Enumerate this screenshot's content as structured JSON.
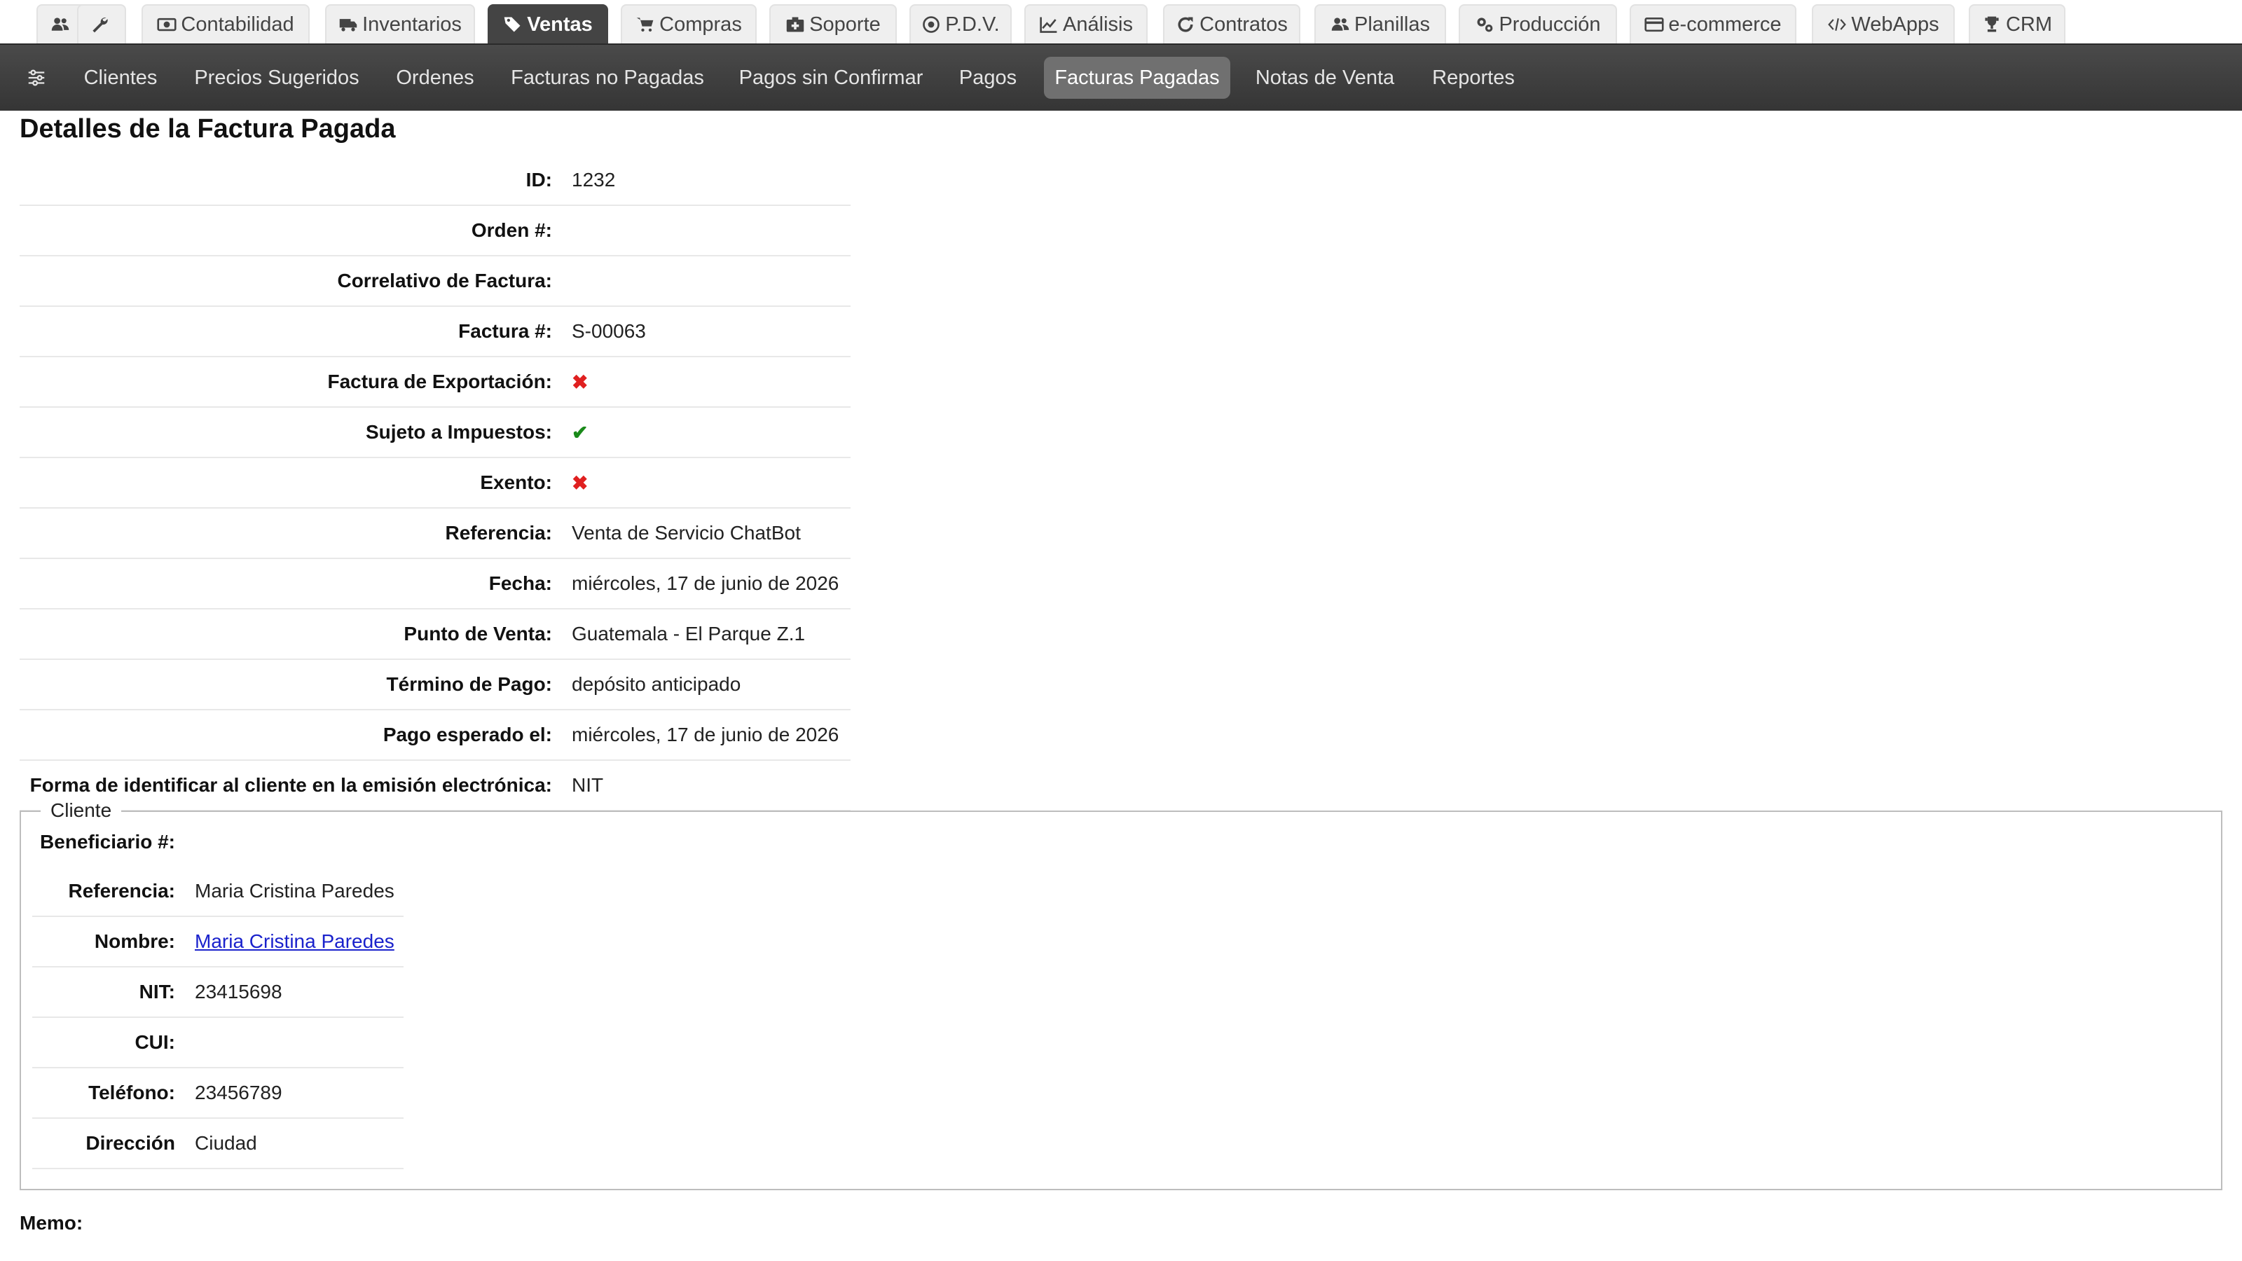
{
  "top_tabs": [
    {
      "label": "",
      "icon": "users-icon"
    },
    {
      "label": "",
      "icon": "wrench-icon"
    },
    {
      "label": "Contabilidad",
      "icon": "money-icon"
    },
    {
      "label": "Inventarios",
      "icon": "truck-icon"
    },
    {
      "label": "Ventas",
      "icon": "tags-icon",
      "active": true
    },
    {
      "label": "Compras",
      "icon": "cart-icon"
    },
    {
      "label": "Soporte",
      "icon": "medkit-icon"
    },
    {
      "label": "P.D.V.",
      "icon": "target-icon"
    },
    {
      "label": "Análisis",
      "icon": "line-chart-icon"
    },
    {
      "label": "Contratos",
      "icon": "refresh-icon"
    },
    {
      "label": "Planillas",
      "icon": "users-icon"
    },
    {
      "label": "Producción",
      "icon": "cogs-icon"
    },
    {
      "label": "e-commerce",
      "icon": "credit-card-icon"
    },
    {
      "label": "WebApps",
      "icon": "code-icon"
    },
    {
      "label": "CRM",
      "icon": "trophy-icon"
    }
  ],
  "subnav": {
    "filter_icon": "sliders-icon",
    "items": [
      {
        "label": "Clientes"
      },
      {
        "label": "Precios Sugeridos"
      },
      {
        "label": "Ordenes"
      },
      {
        "label": "Facturas no Pagadas"
      },
      {
        "label": "Pagos sin Confirmar"
      },
      {
        "label": "Pagos"
      },
      {
        "label": "Facturas Pagadas",
        "active": true
      },
      {
        "label": "Notas de Venta"
      },
      {
        "label": "Reportes"
      }
    ]
  },
  "page_title": "Detalles de la Factura Pagada",
  "details": [
    {
      "label": "ID:",
      "value": "1232"
    },
    {
      "label": "Orden #:",
      "value": ""
    },
    {
      "label": "Correlativo de Factura:",
      "value": ""
    },
    {
      "label": "Factura #:",
      "value": "S-00063"
    },
    {
      "label": "Factura de Exportación:",
      "value": "✖"
    },
    {
      "label": "Sujeto a Impuestos:",
      "value": "✔"
    },
    {
      "label": "Exento:",
      "value": "✖"
    },
    {
      "label": "Referencia:",
      "value": "Venta de Servicio ChatBot"
    },
    {
      "label": "Fecha:",
      "value": "miércoles, 17 de junio de 2026"
    },
    {
      "label": "Punto de Venta:",
      "value": "Guatemala - El Parque Z.1"
    },
    {
      "label": "Término de Pago:",
      "value": "depósito anticipado"
    },
    {
      "label": "Pago esperado el:",
      "value": "miércoles, 17 de junio de 2026"
    },
    {
      "label": "Forma de identificar al cliente en la emisión electrónica:",
      "value": "NIT"
    }
  ],
  "cliente": {
    "legend": "Cliente",
    "rows": [
      {
        "label": "Beneficiario #:",
        "value": ""
      },
      {
        "label": "Referencia:",
        "value": "Maria Cristina Paredes"
      },
      {
        "label": "Nombre:",
        "value": "Maria Cristina Paredes"
      },
      {
        "label": "NIT:",
        "value": "23415698"
      },
      {
        "label": "CUI:",
        "value": ""
      },
      {
        "label": "Teléfono:",
        "value": "23456789"
      },
      {
        "label": "Dirección",
        "value": "Ciudad"
      }
    ]
  },
  "memo_label": "Memo:",
  "colors": {
    "active_tab": "#444444",
    "subnav_bg": "#3d3d3d",
    "check": "#1a8a1a",
    "cross": "#e02020",
    "link": "#1a22cc"
  }
}
